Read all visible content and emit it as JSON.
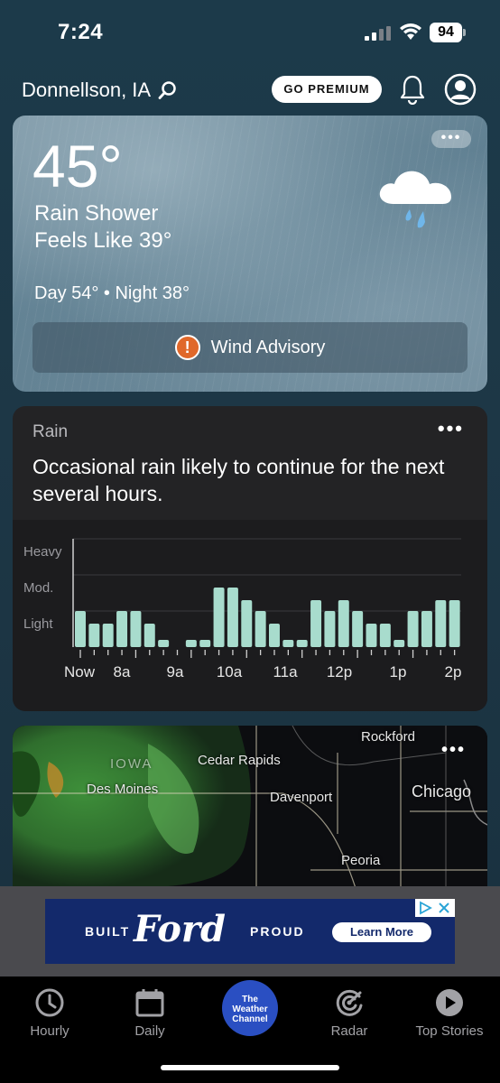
{
  "status_bar": {
    "time": "7:24",
    "battery": "94"
  },
  "header": {
    "location": "Donnellson, IA",
    "premium_label": "GO PREMIUM"
  },
  "current": {
    "more_label": "•••",
    "temperature": "45°",
    "condition": "Rain Shower",
    "feels_like": "Feels Like 39°",
    "day_night": "Day 54° • Night 38°",
    "advisory": "Wind Advisory",
    "advisory_icon": "!",
    "icon": "rain-cloud-icon"
  },
  "rain_card": {
    "title": "Rain",
    "more_label": "•••",
    "description": "Occasional rain likely to continue for the next several hours.",
    "bar_color": "#a8dccd"
  },
  "chart_data": {
    "type": "bar",
    "ylabels": [
      "Heavy",
      "Mod.",
      "Light"
    ],
    "ylim": [
      0,
      3
    ],
    "xtick_labels": [
      "Now",
      "8a",
      "9a",
      "10a",
      "11a",
      "12p",
      "1p",
      "2p"
    ],
    "values": [
      1.0,
      0.65,
      0.65,
      1.0,
      1.0,
      0.65,
      0.2,
      0,
      0.2,
      0.2,
      1.65,
      1.65,
      1.3,
      1.0,
      0.65,
      0.2,
      0.2,
      1.3,
      1.0,
      1.3,
      1.0,
      0.65,
      0.65,
      0.2,
      1.0,
      1.0,
      1.3,
      1.3
    ]
  },
  "radar": {
    "more_label": "•••",
    "labels": [
      "Rockford",
      "Cedar Rapids",
      "IOWA",
      "Des Moines",
      "Davenport",
      "Chicago",
      "Peoria"
    ]
  },
  "ad": {
    "left_text": "BUILT",
    "brand": "Ford",
    "right_text": "PROUD",
    "cta": "Learn More"
  },
  "nav": {
    "items": [
      {
        "label": "Hourly",
        "icon": "clock-icon"
      },
      {
        "label": "Daily",
        "icon": "calendar-icon"
      },
      {
        "label": "The Weather Channel",
        "icon": "twc-logo"
      },
      {
        "label": "Radar",
        "icon": "radar-icon"
      },
      {
        "label": "Top Stories",
        "icon": "play-icon"
      }
    ],
    "twc_line1": "The",
    "twc_line2": "Weather",
    "twc_line3": "Channel"
  }
}
